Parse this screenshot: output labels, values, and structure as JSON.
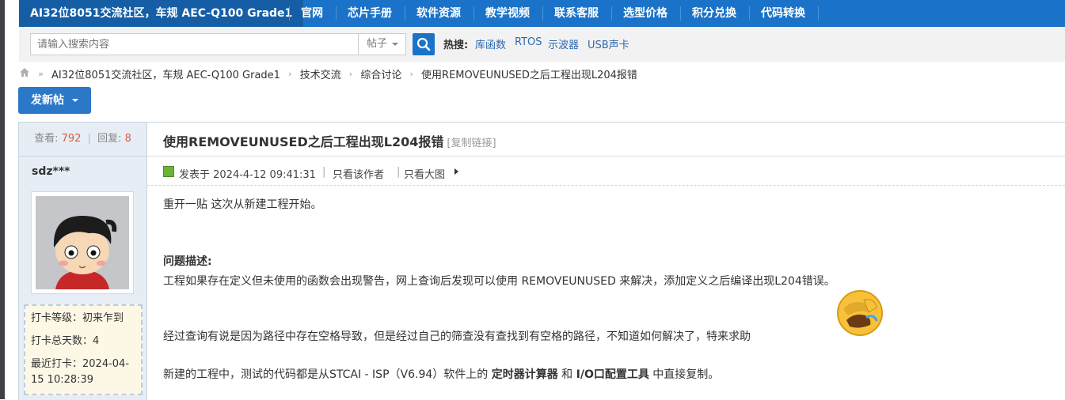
{
  "nav": {
    "brand": "AI32位8051交流社区，车规 AEC-Q100 Grade1",
    "items": [
      "官网",
      "芯片手册",
      "软件资源",
      "教学视频",
      "联系客服",
      "选型价格",
      "积分兑换",
      "代码转换"
    ]
  },
  "search": {
    "placeholder": "请输入搜索内容",
    "type_selected": "帖子",
    "hot_label": "热搜:",
    "hot_items": [
      "库函数",
      "RTOS",
      "示波器",
      "USB声卡"
    ]
  },
  "breadcrumb": {
    "items": [
      "AI32位8051交流社区，车规 AEC-Q100 Grade1",
      "技术交流",
      "综合讨论",
      "使用REMOVEUNUSED之后工程出现L204报错"
    ]
  },
  "new_post_label": "发新帖",
  "post": {
    "views_label": "查看:",
    "views": "792",
    "replies_label": "回复:",
    "replies": "8",
    "title": "使用REMOVEUNUSED之后工程出现L204报错",
    "copy_link": "[复制链接]",
    "author": "sdz***",
    "posted_at": "发表于 2024-4-12 09:41:31",
    "only_author": "只看该作者",
    "only_images": "只看大图",
    "checkin": {
      "level": "打卡等级：初来乍到",
      "total_days": "打卡总天数：4",
      "last": "最近打卡：2024-04-15 10:28:39"
    },
    "body": {
      "line1": "重开一贴 这次从新建工程开始。",
      "heading": "问题描述:",
      "line2": "工程如果存在定义但未使用的函数会出现警告，网上查询后发现可以使用 REMOVEUNUSED 来解决，添加定义之后编译出现L204错误。",
      "line3": "经过查询有说是因为路径中存在空格导致，但是经过自己的筛查没有查找到有空格的路径，不知道如何解决了，特来求助",
      "line4_pre": "新建的工程中，测试的代码都是从STCAI - ISP（V6.94）软件上的 ",
      "line4_b1": "定时器计算器",
      "line4_mid": " 和 ",
      "line4_b2": "I/O口配置工具",
      "line4_post": " 中直接复制。"
    }
  }
}
